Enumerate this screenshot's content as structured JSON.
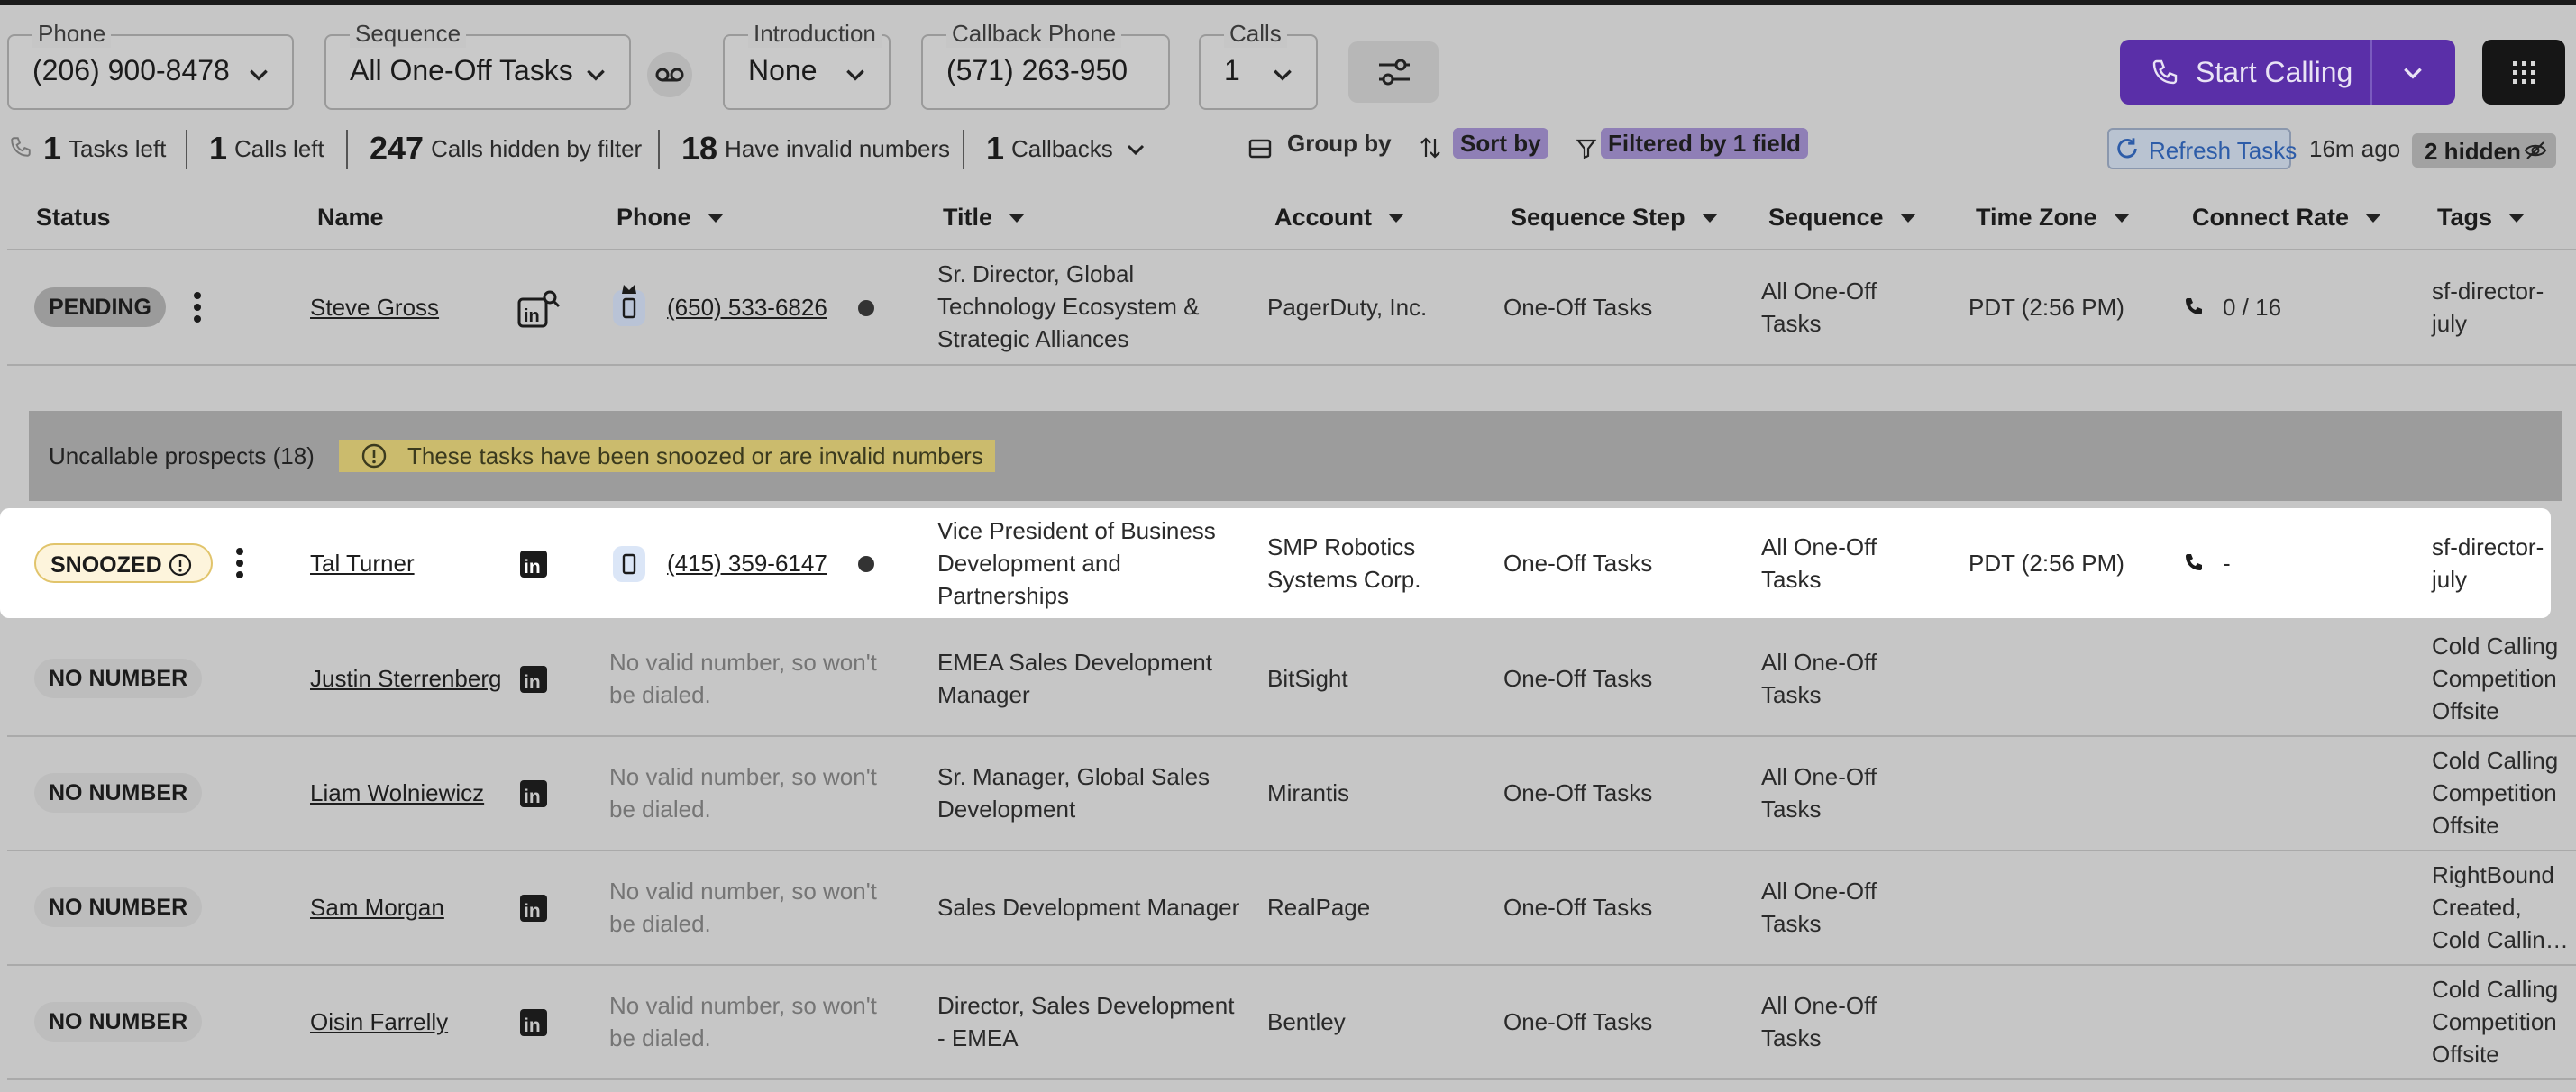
{
  "toolbar": {
    "phone": {
      "label": "Phone",
      "value": "(206) 900-8478"
    },
    "sequence": {
      "label": "Sequence",
      "value": "All One-Off Tasks"
    },
    "introduction": {
      "label": "Introduction",
      "value": "None"
    },
    "callback_phone": {
      "label": "Callback Phone",
      "value": "(571) 263-950"
    },
    "calls": {
      "label": "Calls",
      "value": "1"
    },
    "start_calling": "Start Calling"
  },
  "stats": {
    "tasks_left": {
      "count": "1",
      "label": "Tasks left"
    },
    "calls_left": {
      "count": "1",
      "label": "Calls left"
    },
    "hidden_by_filter": {
      "count": "247",
      "label": "Calls hidden by filter"
    },
    "invalid_numbers": {
      "count": "18",
      "label": "Have invalid numbers"
    },
    "callbacks": {
      "count": "1",
      "label": "Callbacks"
    },
    "group_by": "Group by",
    "sort_by": "Sort by",
    "filtered": "Filtered by 1 field",
    "refresh": "Refresh Tasks",
    "ago": "16m ago",
    "hidden": "2 hidden"
  },
  "columns": {
    "status": "Status",
    "name": "Name",
    "phone": "Phone",
    "title": "Title",
    "account": "Account",
    "sequence_step": "Sequence Step",
    "sequence": "Sequence",
    "time_zone": "Time Zone",
    "connect_rate": "Connect Rate",
    "tags": "Tags"
  },
  "pending_row": {
    "status": "PENDING",
    "name": "Steve Gross",
    "phone": "(650) 533-6826",
    "title_lines": [
      "Sr. Director, Global",
      "Technology Ecosystem &",
      "Strategic Alliances"
    ],
    "account": "PagerDuty, Inc.",
    "sequence_step": "One-Off Tasks",
    "sequence_lines": [
      "All One-Off",
      "Tasks"
    ],
    "time_zone": "PDT (2:56 PM)",
    "connect_rate": "0 / 16",
    "tags_lines": [
      "sf-director-",
      "july"
    ]
  },
  "group": {
    "title": "Uncallable prospects (18)",
    "warning": "These tasks have been snoozed or are invalid numbers"
  },
  "snoozed_row": {
    "status": "SNOOZED",
    "name": "Tal Turner",
    "phone": "(415) 359-6147",
    "title_lines": [
      "Vice President of Business",
      "Development and",
      "Partnerships"
    ],
    "account_lines": [
      "SMP Robotics",
      "Systems Corp."
    ],
    "sequence_step": "One-Off Tasks",
    "sequence_lines": [
      "All One-Off",
      "Tasks"
    ],
    "time_zone": "PDT (2:56 PM)",
    "connect_rate": "-",
    "tags_lines": [
      "sf-director-",
      "july"
    ]
  },
  "no_number_text": [
    "No valid number, so won't",
    "be dialed."
  ],
  "no_number_rows": [
    {
      "status": "NO NUMBER",
      "name": "Justin Sterrenberg",
      "title_lines": [
        "EMEA Sales Development",
        "Manager"
      ],
      "account": "BitSight",
      "sequence_step": "One-Off Tasks",
      "sequence_lines": [
        "All One-Off",
        "Tasks"
      ],
      "tags_lines": [
        "Cold Calling",
        "Competition",
        "Offsite"
      ]
    },
    {
      "status": "NO NUMBER",
      "name": "Liam Wolniewicz",
      "title_lines": [
        "Sr. Manager, Global Sales",
        "Development"
      ],
      "account": "Mirantis",
      "sequence_step": "One-Off Tasks",
      "sequence_lines": [
        "All One-Off",
        "Tasks"
      ],
      "tags_lines": [
        "Cold Calling",
        "Competition",
        "Offsite"
      ]
    },
    {
      "status": "NO NUMBER",
      "name": "Sam Morgan",
      "title_lines": [
        "Sales Development Manager"
      ],
      "account": "RealPage",
      "sequence_step": "One-Off Tasks",
      "sequence_lines": [
        "All One-Off",
        "Tasks"
      ],
      "tags_lines": [
        "RightBound",
        "Created,",
        "Cold Callin…"
      ]
    },
    {
      "status": "NO NUMBER",
      "name": "Oisin Farrelly",
      "title_lines": [
        "Director, Sales Development",
        "- EMEA"
      ],
      "account": "Bentley",
      "sequence_step": "One-Off Tasks",
      "sequence_lines": [
        "All One-Off",
        "Tasks"
      ],
      "tags_lines": [
        "Cold Calling",
        "Competition",
        "Offsite"
      ]
    }
  ]
}
